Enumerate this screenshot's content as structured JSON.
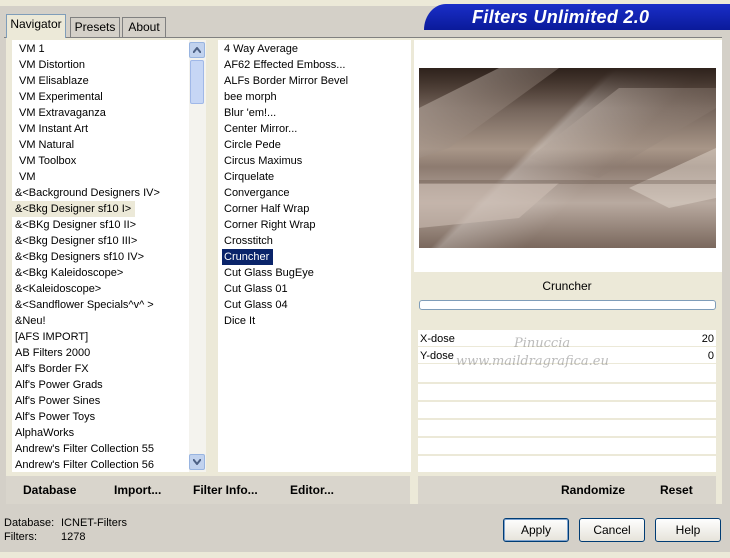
{
  "app": {
    "title": "Filters Unlimited 2.0"
  },
  "tabs": [
    {
      "label": "Navigator",
      "active": true
    },
    {
      "label": "Presets",
      "active": false
    },
    {
      "label": "About",
      "active": false
    }
  ],
  "categories": [
    "VM 1",
    "VM Distortion",
    "VM Elisablaze",
    "VM Experimental",
    "VM Extravaganza",
    "VM Instant Art",
    "VM Natural",
    "VM Toolbox",
    "VM",
    "&<Background Designers IV>",
    "&<Bkg Designer sf10 I>",
    "&<BKg Designer sf10 II>",
    "&<Bkg Designer sf10 III>",
    "&<Bkg Designers sf10 IV>",
    "&<Bkg Kaleidoscope>",
    "&<Kaleidoscope>",
    "&<Sandflower Specials^v^ >",
    "&Neu!",
    "[AFS IMPORT]",
    "AB Filters 2000",
    "Alf's Border FX",
    "Alf's Power Grads",
    "Alf's Power Sines",
    "Alf's Power Toys",
    "AlphaWorks",
    "Andrew's Filter Collection 55",
    "Andrew's Filter Collection 56"
  ],
  "selected_category": "&<Bkg Designer sf10 I>",
  "filters": [
    "4 Way Average",
    "AF62 Effected Emboss...",
    "ALFs Border Mirror Bevel",
    "bee morph",
    "Blur 'em!...",
    "Center Mirror...",
    "Circle Pede",
    "Circus Maximus",
    "Cirquelate",
    "Convergance",
    "Corner Half Wrap",
    "Corner Right Wrap",
    "Crosstitch",
    "Cruncher",
    "Cut Glass  BugEye",
    "Cut Glass 01",
    "Cut Glass 04",
    "Dice It"
  ],
  "selected_filter": "Cruncher",
  "preview": {
    "filter_name": "Cruncher",
    "progress": 0
  },
  "params": [
    {
      "label": "X-dose",
      "value": "20"
    },
    {
      "label": "Y-dose",
      "value": "0"
    }
  ],
  "watermark": {
    "line1": "Pinuccia",
    "line2": "www.maildragrafica.eu"
  },
  "bottom_links": {
    "database": "Database",
    "import": "Import...",
    "filter_info": "Filter Info...",
    "editor": "Editor...",
    "randomize": "Randomize",
    "reset": "Reset"
  },
  "status": {
    "database_label": "Database:",
    "database_value": "ICNET-Filters",
    "filters_label": "Filters:",
    "filters_value": "1278"
  },
  "buttons": {
    "apply": "Apply",
    "cancel": "Cancel",
    "help": "Help"
  },
  "colors": {
    "banner": "#0a1a9a",
    "selection": "#0a246a",
    "dialog_bg": "#d4d0c8"
  }
}
